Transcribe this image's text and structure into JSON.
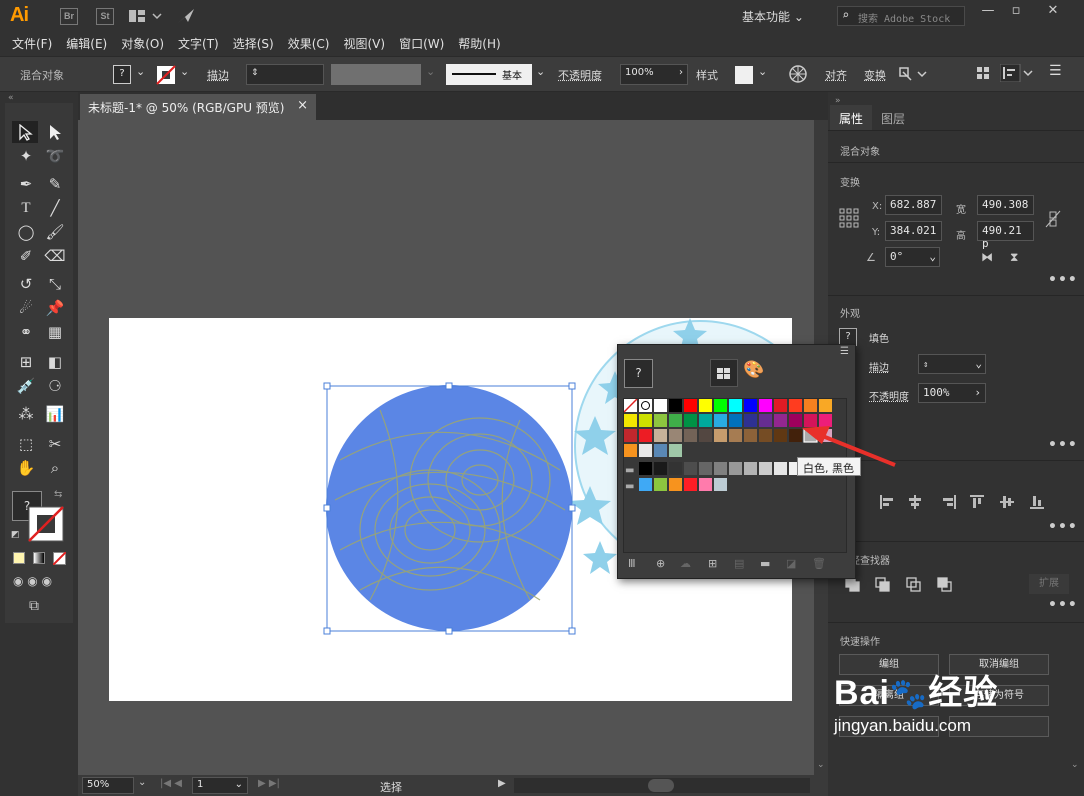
{
  "app": {
    "logo": "Ai",
    "bridge_label": "Br",
    "stock_label": "St",
    "workspace": "基本功能",
    "search_placeholder": "搜索 Adobe Stock"
  },
  "menu": [
    "文件(F)",
    "编辑(E)",
    "对象(O)",
    "文字(T)",
    "选择(S)",
    "效果(C)",
    "视图(V)",
    "窗口(W)",
    "帮助(H)"
  ],
  "control": {
    "object_type": "混合对象",
    "fill_label": "?",
    "stroke_label": "描边",
    "stroke_style": "基本",
    "opacity_label": "不透明度",
    "opacity_value": "100%",
    "style_label": "样式",
    "align_label": "对齐",
    "transform_label": "变换"
  },
  "document": {
    "tab_title": "未标题-1* @ 50% (RGB/GPU 预览)",
    "close": "×"
  },
  "status": {
    "zoom": "50%",
    "page": "1",
    "mode": "选择"
  },
  "panel": {
    "tabs": [
      "属性",
      "图层"
    ],
    "object_type": "混合对象",
    "transform_title": "变换",
    "x_label": "X:",
    "x": "682.887",
    "y_label": "Y:",
    "y": "384.021",
    "w_label": "宽",
    "w": "490.308",
    "h_label": "高",
    "h": "490.21 p",
    "angle": "0°",
    "appearance_title": "外观",
    "fill_label": "填色",
    "fill_swatch": "?",
    "stroke_label": "描边",
    "opacity_label": "不透明度",
    "opacity": "100%",
    "pathfinder_title": "路径查找器",
    "quick_title": "快速操作",
    "quick_buttons": [
      "编组",
      "取消编组",
      "隔离组",
      "存储为符号"
    ],
    "expand_label": "扩展"
  },
  "popup": {
    "current_swatch": "?",
    "tooltip": "白色, 黑色",
    "grid_colors": [
      [
        "none",
        "reg",
        "#ffffff",
        "#000000",
        "#ff0000",
        "#ffff00",
        "#00ff00",
        "#00ffff",
        "#0000ff",
        "#ff00ff",
        "#e01b24",
        "#ff3c1f",
        "#f5801f",
        "#f9a825"
      ],
      [
        "#f2e600",
        "#cde000",
        "#8dc63f",
        "#3fae49",
        "#009245",
        "#00a99d",
        "#29abe2",
        "#0071bc",
        "#2e3192",
        "#662d91",
        "#93278f",
        "#9e005d",
        "#d4145a",
        "#ed1e79"
      ],
      [
        "#c1272d",
        "#ed1c24",
        "#c7b299",
        "#998675",
        "#736357",
        "#534741",
        "#c69c6d",
        "#a67c52",
        "#8c6239",
        "#754c24",
        "#603813",
        "#42210b",
        "grad",
        "pattern"
      ],
      [
        "#f7931e",
        "pattern2",
        "pattern3",
        "pattern4"
      ]
    ],
    "gray_row": [
      "#000000",
      "#1a1a1a",
      "#333333",
      "#4d4d4d",
      "#666666",
      "#808080",
      "#999999",
      "#b3b3b3",
      "#cccccc",
      "#e6e6e6",
      "#f2f2f2"
    ],
    "group_row": [
      "#3fa9f5",
      "#8cc63f",
      "#f7931e",
      "#ff1d25",
      "#ff7bac",
      "#bdccd4"
    ]
  },
  "watermark": {
    "brand": "Bai",
    "brand2": "经验",
    "url": "jingyan.baidu.com"
  }
}
